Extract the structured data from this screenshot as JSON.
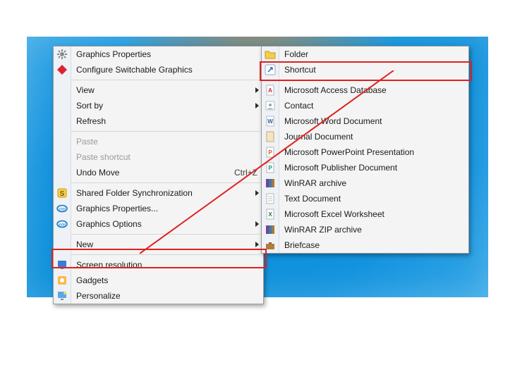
{
  "menu1": {
    "items": [
      {
        "k": "gfxprops",
        "label": "Graphics Properties"
      },
      {
        "k": "swgfx",
        "label": "Configure Switchable Graphics"
      },
      {
        "sep": true
      },
      {
        "k": "view",
        "label": "View",
        "submenu": true
      },
      {
        "k": "sortby",
        "label": "Sort by",
        "submenu": true
      },
      {
        "k": "refresh",
        "label": "Refresh"
      },
      {
        "sep": true
      },
      {
        "k": "paste",
        "label": "Paste",
        "disabled": true
      },
      {
        "k": "pastesc",
        "label": "Paste shortcut",
        "disabled": true
      },
      {
        "k": "undomove",
        "label": "Undo Move",
        "shortcut": "Ctrl+Z"
      },
      {
        "sep": true
      },
      {
        "k": "sharedfolder",
        "label": "Shared Folder Synchronization",
        "submenu": true
      },
      {
        "k": "gfxprops2",
        "label": "Graphics Properties..."
      },
      {
        "k": "gfxopts",
        "label": "Graphics Options",
        "submenu": true
      },
      {
        "sep": true
      },
      {
        "k": "new",
        "label": "New",
        "submenu": true,
        "highlight": true
      },
      {
        "sep": true
      },
      {
        "k": "screenres",
        "label": "Screen resolution"
      },
      {
        "k": "gadgets",
        "label": "Gadgets"
      },
      {
        "k": "personalize",
        "label": "Personalize"
      }
    ]
  },
  "menu2": {
    "items": [
      {
        "k": "folder",
        "label": "Folder"
      },
      {
        "k": "shortcut",
        "label": "Shortcut",
        "highlight": true
      },
      {
        "sep": true
      },
      {
        "k": "access",
        "label": "Microsoft Access Database"
      },
      {
        "k": "contact",
        "label": "Contact"
      },
      {
        "k": "word",
        "label": "Microsoft Word Document"
      },
      {
        "k": "journal",
        "label": "Journal Document"
      },
      {
        "k": "ppt",
        "label": "Microsoft PowerPoint Presentation"
      },
      {
        "k": "pub",
        "label": "Microsoft Publisher Document"
      },
      {
        "k": "rar",
        "label": "WinRAR archive"
      },
      {
        "k": "txt",
        "label": "Text Document"
      },
      {
        "k": "xls",
        "label": "Microsoft Excel Worksheet"
      },
      {
        "k": "zip",
        "label": "WinRAR ZIP archive"
      },
      {
        "k": "briefcase",
        "label": "Briefcase"
      }
    ]
  },
  "icons": {
    "gfxprops": "gear",
    "swgfx": "diamond",
    "sharedfolder": "s-box",
    "gfxprops2": "intel",
    "gfxopts": "intel",
    "screenres": "monitor",
    "gadgets": "gadget",
    "personalize": "palette",
    "folder": "folder",
    "shortcut": "shortcut",
    "access": "file-red",
    "contact": "contact",
    "word": "file-blue",
    "journal": "file-tan",
    "ppt": "file-orange",
    "pub": "file-teal",
    "rar": "books",
    "txt": "file-plain",
    "xls": "file-green",
    "zip": "books",
    "briefcase": "briefcase"
  },
  "colors": {
    "highlight": "#e02020"
  }
}
